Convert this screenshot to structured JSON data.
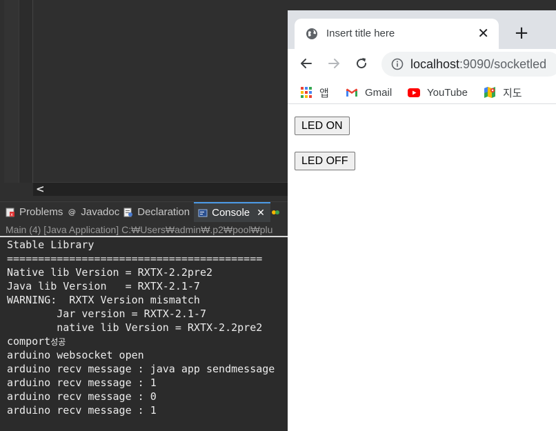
{
  "ide": {
    "hscroll_arrow": "<",
    "tabs": [
      {
        "label": "Problems",
        "icon": "problems-icon"
      },
      {
        "label": "Javadoc",
        "icon": "javadoc-icon"
      },
      {
        "label": "Declaration",
        "icon": "declaration-icon"
      },
      {
        "label": "Console",
        "icon": "console-icon",
        "close": "✕"
      }
    ],
    "console_title": "Main (4) [Java Application] C:₩Users₩admin₩.p2₩pool₩plu",
    "console_lines": [
      "Stable Library",
      "=========================================",
      "Native lib Version = RXTX-2.2pre2",
      "Java lib Version   = RXTX-2.1-7",
      "WARNING:  RXTX Version mismatch",
      "        Jar version = RXTX-2.1-7",
      "        native lib Version = RXTX-2.2pre2",
      "comport",
      "arduino websocket open",
      "arduino recv message : java app sendmessage",
      "arduino recv message : 1",
      "arduino recv message : 0",
      "arduino recv message : 1"
    ],
    "comport_suffix": "성공"
  },
  "browser": {
    "tab_title": "Insert title here",
    "tab_close": "✕",
    "new_tab": "+",
    "url_host": "localhost",
    "url_rest": ":9090/socketled",
    "bookmarks": [
      {
        "label": "앱",
        "icon": "apps-grid-icon"
      },
      {
        "label": "Gmail",
        "icon": "gmail-icon"
      },
      {
        "label": "YouTube",
        "icon": "youtube-icon"
      },
      {
        "label": "지도",
        "icon": "maps-icon"
      }
    ],
    "buttons": {
      "led_on": "LED ON",
      "led_off": "LED OFF"
    }
  }
}
